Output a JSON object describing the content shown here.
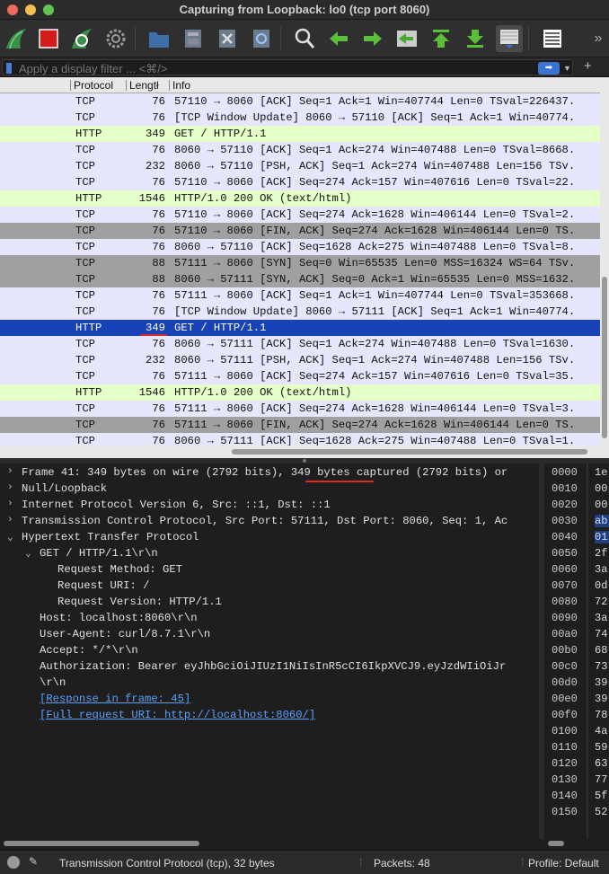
{
  "window": {
    "title": "Capturing from Loopback: lo0 (tcp port 8060)"
  },
  "filter": {
    "placeholder": "Apply a display filter ... <⌘/>",
    "apply_icon": "arrow-right-icon",
    "add_icon": "plus-icon"
  },
  "columns": {
    "protocol": "Protocol",
    "length": "Lengtł",
    "info": "Info"
  },
  "packets": [
    {
      "protocol": "TCP",
      "length": "76",
      "info": "57110 → 8060 [ACK] Seq=1 Ack=1 Win=407744 Len=0 TSval=226437.",
      "kind": "tcp"
    },
    {
      "protocol": "TCP",
      "length": "76",
      "info": "[TCP Window Update] 8060 → 57110 [ACK] Seq=1 Ack=1 Win=40774.",
      "kind": "tcp"
    },
    {
      "protocol": "HTTP",
      "length": "349",
      "info": "GET / HTTP/1.1",
      "kind": "http"
    },
    {
      "protocol": "TCP",
      "length": "76",
      "info": "8060 → 57110 [ACK] Seq=1 Ack=274 Win=407488 Len=0 TSval=8668.",
      "kind": "tcp"
    },
    {
      "protocol": "TCP",
      "length": "232",
      "info": "8060 → 57110 [PSH, ACK] Seq=1 Ack=274 Win=407488 Len=156 TSv.",
      "kind": "tcp"
    },
    {
      "protocol": "TCP",
      "length": "76",
      "info": "57110 → 8060 [ACK] Seq=274 Ack=157 Win=407616 Len=0 TSval=22.",
      "kind": "tcp"
    },
    {
      "protocol": "HTTP",
      "length": "1546",
      "info": "HTTP/1.0 200 OK  (text/html)",
      "kind": "http"
    },
    {
      "protocol": "TCP",
      "length": "76",
      "info": "57110 → 8060 [ACK] Seq=274 Ack=1628 Win=406144 Len=0 TSval=2.",
      "kind": "tcp"
    },
    {
      "protocol": "TCP",
      "length": "76",
      "info": "57110 → 8060 [FIN, ACK] Seq=274 Ack=1628 Win=406144 Len=0 TS.",
      "kind": "fin"
    },
    {
      "protocol": "TCP",
      "length": "76",
      "info": "8060 → 57110 [ACK] Seq=1628 Ack=275 Win=407488 Len=0 TSval=8.",
      "kind": "tcp"
    },
    {
      "protocol": "TCP",
      "length": "88",
      "info": "57111 → 8060 [SYN] Seq=0 Win=65535 Len=0 MSS=16324 WS=64 TSv.",
      "kind": "fin"
    },
    {
      "protocol": "TCP",
      "length": "88",
      "info": "8060 → 57111 [SYN, ACK] Seq=0 Ack=1 Win=65535 Len=0 MSS=1632.",
      "kind": "fin"
    },
    {
      "protocol": "TCP",
      "length": "76",
      "info": "57111 → 8060 [ACK] Seq=1 Ack=1 Win=407744 Len=0 TSval=353668.",
      "kind": "tcp"
    },
    {
      "protocol": "TCP",
      "length": "76",
      "info": "[TCP Window Update] 8060 → 57111 [ACK] Seq=1 Ack=1 Win=40774.",
      "kind": "tcp"
    },
    {
      "protocol": "HTTP",
      "length": "349",
      "info": "GET / HTTP/1.1",
      "kind": "sel"
    },
    {
      "protocol": "TCP",
      "length": "76",
      "info": "8060 → 57111 [ACK] Seq=1 Ack=274 Win=407488 Len=0 TSval=1630.",
      "kind": "tcp"
    },
    {
      "protocol": "TCP",
      "length": "232",
      "info": "8060 → 57111 [PSH, ACK] Seq=1 Ack=274 Win=407488 Len=156 TSv.",
      "kind": "tcp"
    },
    {
      "protocol": "TCP",
      "length": "76",
      "info": "57111 → 8060 [ACK] Seq=274 Ack=157 Win=407616 Len=0 TSval=35.",
      "kind": "tcp"
    },
    {
      "protocol": "HTTP",
      "length": "1546",
      "info": "HTTP/1.0 200 OK  (text/html)",
      "kind": "http"
    },
    {
      "protocol": "TCP",
      "length": "76",
      "info": "57111 → 8060 [ACK] Seq=274 Ack=1628 Win=406144 Len=0 TSval=3.",
      "kind": "tcp"
    },
    {
      "protocol": "TCP",
      "length": "76",
      "info": "57111 → 8060 [FIN, ACK] Seq=274 Ack=1628 Win=406144 Len=0 TS.",
      "kind": "fin"
    },
    {
      "protocol": "TCP",
      "length": "76",
      "info": "8060 → 57111 [ACK] Seq=1628 Ack=275 Win=407488 Len=0 TSval=1.",
      "kind": "tcp"
    }
  ],
  "details": [
    {
      "toggle": "›",
      "indent": 0,
      "text": "Frame 41: 349 bytes on wire (2792 bits), 349 bytes captured (2792 bits) or",
      "link": false
    },
    {
      "toggle": "›",
      "indent": 0,
      "text": "Null/Loopback",
      "link": false
    },
    {
      "toggle": "›",
      "indent": 0,
      "text": "Internet Protocol Version 6, Src: ::1, Dst: ::1",
      "link": false
    },
    {
      "toggle": "›",
      "indent": 0,
      "text": "Transmission Control Protocol, Src Port: 57111, Dst Port: 8060, Seq: 1, Ac",
      "link": false
    },
    {
      "toggle": "⌄",
      "indent": 0,
      "text": "Hypertext Transfer Protocol",
      "link": false
    },
    {
      "toggle": "⌄",
      "indent": 1,
      "text": "GET / HTTP/1.1\\r\\n",
      "link": false
    },
    {
      "toggle": "",
      "indent": 2,
      "text": "Request Method: GET",
      "link": false
    },
    {
      "toggle": "",
      "indent": 2,
      "text": "Request URI: /",
      "link": false
    },
    {
      "toggle": "",
      "indent": 2,
      "text": "Request Version: HTTP/1.1",
      "link": false
    },
    {
      "toggle": "",
      "indent": 1,
      "text": "Host: localhost:8060\\r\\n",
      "link": false
    },
    {
      "toggle": "",
      "indent": 1,
      "text": "User-Agent: curl/8.7.1\\r\\n",
      "link": false
    },
    {
      "toggle": "",
      "indent": 1,
      "text": "Accept: */*\\r\\n",
      "link": false
    },
    {
      "toggle": "",
      "indent": 1,
      "text": "Authorization: Bearer eyJhbGciOiJIUzI1NiIsInR5cCI6IkpXVCJ9.eyJzdWIiOiJr",
      "link": false
    },
    {
      "toggle": "",
      "indent": 1,
      "text": "\\r\\n",
      "link": false
    },
    {
      "toggle": "",
      "indent": 1,
      "text": "[Response in frame: 45]",
      "link": true
    },
    {
      "toggle": "",
      "indent": 1,
      "text": "[Full request URI: http://localhost:8060/]",
      "link": true
    }
  ],
  "hex": {
    "offsets": [
      "0000",
      "0010",
      "0020",
      "0030",
      "0040",
      "0050",
      "0060",
      "0070",
      "0080",
      "0090",
      "00a0",
      "00b0",
      "00c0",
      "00d0",
      "00e0",
      "00f0",
      "0100",
      "0110",
      "0120",
      "0130",
      "0140",
      "0150"
    ],
    "bytes": [
      "1e",
      "00",
      "00",
      "ab",
      "01",
      "2f",
      "3a",
      "0d",
      "72",
      "3a",
      "74",
      "68",
      "73",
      "39",
      "39",
      "78",
      "4a",
      "59",
      "63",
      "77",
      "5f",
      "52"
    ],
    "selected": [
      3,
      4
    ]
  },
  "status": {
    "field": "Transmission Control Protocol (tcp), 32 bytes",
    "packets": "Packets: 48",
    "profile": "Profile: Default"
  },
  "colors": {
    "tcp_row": "#e7e6ff",
    "http_row": "#e4ffc7",
    "fin_row": "#a0a0a0",
    "selected_row": "#1842b7",
    "annotation": "#d82a2a"
  },
  "toolbar": [
    {
      "name": "shark-fin-start-icon"
    },
    {
      "name": "stop-capture-icon"
    },
    {
      "name": "restart-capture-icon"
    },
    {
      "name": "capture-options-gear-icon"
    },
    {
      "name": "open-file-icon"
    },
    {
      "name": "save-file-icon"
    },
    {
      "name": "close-file-icon"
    },
    {
      "name": "reload-file-icon"
    },
    {
      "name": "find-packet-icon"
    },
    {
      "name": "go-back-icon"
    },
    {
      "name": "go-forward-icon"
    },
    {
      "name": "go-to-packet-icon"
    },
    {
      "name": "go-first-icon"
    },
    {
      "name": "go-last-icon"
    },
    {
      "name": "autoscroll-icon"
    },
    {
      "name": "colorize-icon"
    },
    {
      "name": "more-chevron-icon"
    }
  ]
}
